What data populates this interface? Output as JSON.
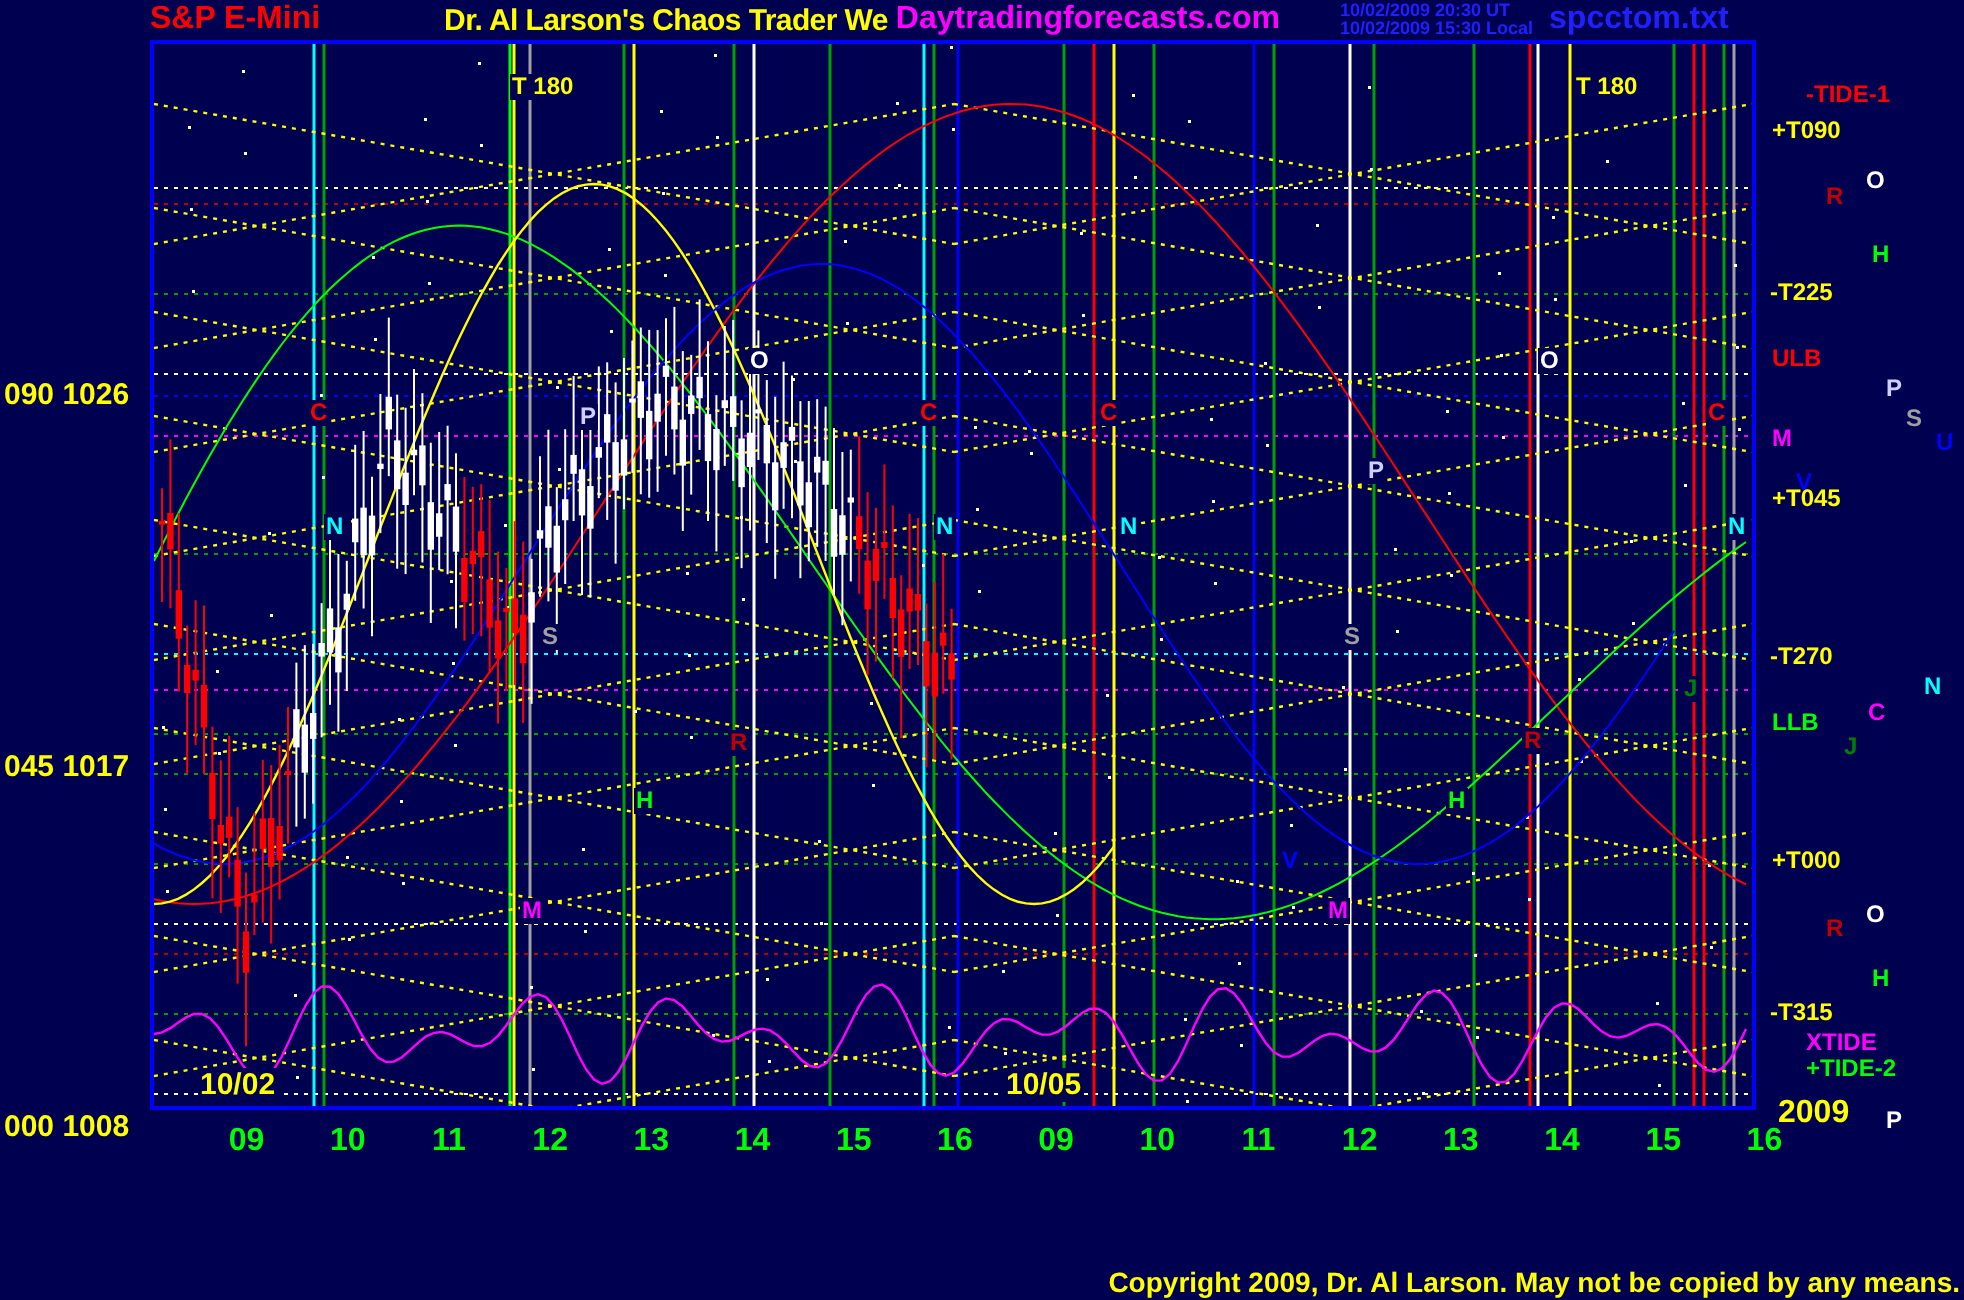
{
  "header": {
    "symbol": "S&P E-Mini",
    "title": "Dr. Al Larson's Chaos Trader We",
    "site": "Daytradingforecasts.com",
    "time_ut": "10/02/2009 20:30 UT",
    "time_local": "10/02/2009 15:30 Local",
    "filename": "spcctom.txt"
  },
  "y_axis": {
    "labels": [
      "090 1026",
      "045 1017",
      "000 1008"
    ]
  },
  "chart": {
    "date_labels": [
      "10/02",
      "10/05"
    ],
    "markers": [
      {
        "label": "T  180",
        "color": "#ffff00"
      },
      {
        "label": "C",
        "color": "#ff0000"
      },
      {
        "label": "N",
        "color": "#00ffff"
      },
      {
        "label": "P",
        "color": "#d0d0ff"
      },
      {
        "label": "S",
        "color": "#a0a0a0"
      },
      {
        "label": "O",
        "color": "#ffffff"
      },
      {
        "label": "R",
        "color": "#c00000"
      },
      {
        "label": "H",
        "color": "#00ff00"
      },
      {
        "label": "M",
        "color": "#ff00ff"
      },
      {
        "label": "C",
        "color": "#ff0000"
      },
      {
        "label": "N",
        "color": "#00ffff"
      },
      {
        "label": "T  180",
        "color": "#ffff00"
      },
      {
        "label": "C",
        "color": "#ff0000"
      },
      {
        "label": "N",
        "color": "#00ffff"
      },
      {
        "label": "P",
        "color": "#d0d0ff"
      },
      {
        "label": "S",
        "color": "#a0a0a0"
      },
      {
        "label": "O",
        "color": "#ffffff"
      },
      {
        "label": "R",
        "color": "#c00000"
      },
      {
        "label": "H",
        "color": "#00ff00"
      },
      {
        "label": "M",
        "color": "#ff00ff"
      },
      {
        "label": "V",
        "color": "#0000ff"
      },
      {
        "label": "C",
        "color": "#ff0000"
      },
      {
        "label": "N",
        "color": "#00ffff"
      },
      {
        "label": "J",
        "color": "#008000"
      }
    ]
  },
  "right_labels": [
    {
      "label": "-TIDE-1",
      "color": "#ff0000"
    },
    {
      "label": "+T090",
      "color": "#ffff00"
    },
    {
      "label": "O",
      "color": "#ffffff"
    },
    {
      "label": "R",
      "color": "#c00000"
    },
    {
      "label": "-T225",
      "color": "#ffff00"
    },
    {
      "label": "H",
      "color": "#00ff00"
    },
    {
      "label": "ULB",
      "color": "#ff0000"
    },
    {
      "label": "P",
      "color": "#d0d0ff"
    },
    {
      "label": "S",
      "color": "#a0a0a0"
    },
    {
      "label": "U",
      "color": "#0000ff"
    },
    {
      "label": "M",
      "color": "#ff00ff"
    },
    {
      "label": "V",
      "color": "#0000ff"
    },
    {
      "label": "+T045",
      "color": "#ffff00"
    },
    {
      "label": "-T270",
      "color": "#ffff00"
    },
    {
      "label": "N",
      "color": "#00ffff"
    },
    {
      "label": "C",
      "color": "#ff00ff"
    },
    {
      "label": "LLB",
      "color": "#00ff00"
    },
    {
      "label": "J",
      "color": "#008000"
    },
    {
      "label": "+T000",
      "color": "#ffff00"
    },
    {
      "label": "O",
      "color": "#ffffff"
    },
    {
      "label": "R",
      "color": "#c00000"
    },
    {
      "label": "-T315",
      "color": "#ffff00"
    },
    {
      "label": "H",
      "color": "#00ff00"
    },
    {
      "label": "XTIDE",
      "color": "#ff00ff"
    },
    {
      "label": "+TIDE-2",
      "color": "#00ff00"
    },
    {
      "label": "2009",
      "color": "#ffff00"
    },
    {
      "label": "P",
      "color": "#ffffff"
    }
  ],
  "x_axis": {
    "labels": [
      "09",
      "10",
      "11",
      "12",
      "13",
      "14",
      "15",
      "16",
      "09",
      "10",
      "11",
      "12",
      "13",
      "14",
      "15",
      "16"
    ]
  },
  "copyright": "Copyright 2009, Dr. Al Larson. May not be copied by any means."
}
